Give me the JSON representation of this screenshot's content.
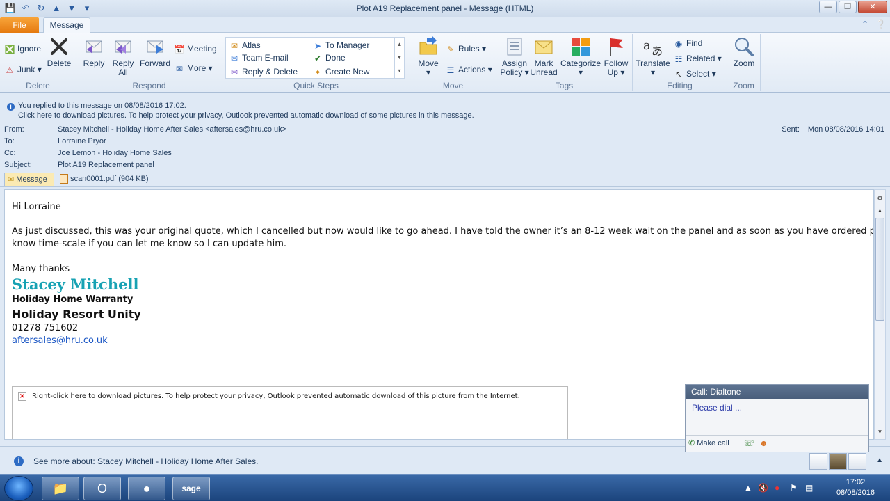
{
  "window": {
    "title": "Plot A19 Replacement panel  -  Message (HTML)"
  },
  "tabs": {
    "file": "File",
    "message": "Message"
  },
  "ribbon": {
    "delete_group": {
      "label": "Delete",
      "ignore": "Ignore",
      "junk": "Junk",
      "delete": "Delete"
    },
    "respond_group": {
      "label": "Respond",
      "reply": "Reply",
      "reply_all_1": "Reply",
      "reply_all_2": "All",
      "forward": "Forward",
      "meeting": "Meeting",
      "more": "More"
    },
    "quicksteps_group": {
      "label": "Quick Steps",
      "items": [
        "Atlas",
        "Team E-mail",
        "Reply & Delete",
        "To Manager",
        "Done",
        "Create New"
      ]
    },
    "move_group": {
      "label": "Move",
      "move": "Move",
      "rules": "Rules",
      "actions": "Actions"
    },
    "tags_group": {
      "label": "Tags",
      "assign_1": "Assign",
      "assign_2": "Policy",
      "mark_1": "Mark",
      "mark_2": "Unread",
      "categorize": "Categorize",
      "follow_1": "Follow",
      "follow_2": "Up"
    },
    "editing_group": {
      "label": "Editing",
      "translate": "Translate",
      "find": "Find",
      "related": "Related",
      "select": "Select"
    },
    "zoom_group": {
      "label": "Zoom",
      "zoom": "Zoom"
    }
  },
  "infobar": {
    "replied": "You replied to this message on 08/08/2016 17:02.",
    "pictures": "Click here to download pictures. To help protect your privacy, Outlook prevented automatic download of some pictures in this message."
  },
  "headers": {
    "from_label": "From:",
    "from": "Stacey Mitchell - Holiday Home After Sales <aftersales@hru.co.uk>",
    "to_label": "To:",
    "to": "Lorraine Pryor",
    "cc_label": "Cc:",
    "cc": "Joe Lemon - Holiday Home Sales",
    "subject_label": "Subject:",
    "subject": "Plot A19 Replacement panel",
    "sent_label": "Sent:",
    "sent": "Mon 08/08/2016 14:01"
  },
  "attachments": {
    "message": "Message",
    "file": "scan0001.pdf",
    "file_size": "(904 KB)"
  },
  "body": {
    "greeting": "Hi Lorraine",
    "para1_line1": "As just discussed, this was your original quote, which I cancelled but now would like to go ahead. I have told the owner it’s an 8-12 week wait on the panel and as soon as you have ordered parts and",
    "para1_line2": "know time-scale if you can let me know so I can update him.",
    "closing": "Many thanks",
    "sig_name": "Stacey Mitchell",
    "sig_title": "Holiday Home Warranty",
    "sig_company": "Holiday Resort Unity",
    "sig_phone": "01278 751602",
    "sig_email": "aftersales@hru.co.uk",
    "blocked_picture": "Right-click here to download pictures.  To help protect your privacy, Outlook prevented automatic download of this picture from the Internet."
  },
  "call_popup": {
    "header": "Call: Dialtone",
    "prompt": "Please dial ...",
    "make_call": "Make call"
  },
  "people_pane": {
    "text": "See more about: Stacey Mitchell - Holiday Home After Sales."
  },
  "taskbar": {
    "time": "17:02",
    "date": "08/08/2016",
    "apps": [
      "file-explorer-icon",
      "outlook-icon",
      "firefox-icon",
      "sage-icon"
    ]
  },
  "colors": {
    "file_tab": "#e57a0f",
    "signature_name": "#17a2b3",
    "link": "#1a56c4"
  }
}
